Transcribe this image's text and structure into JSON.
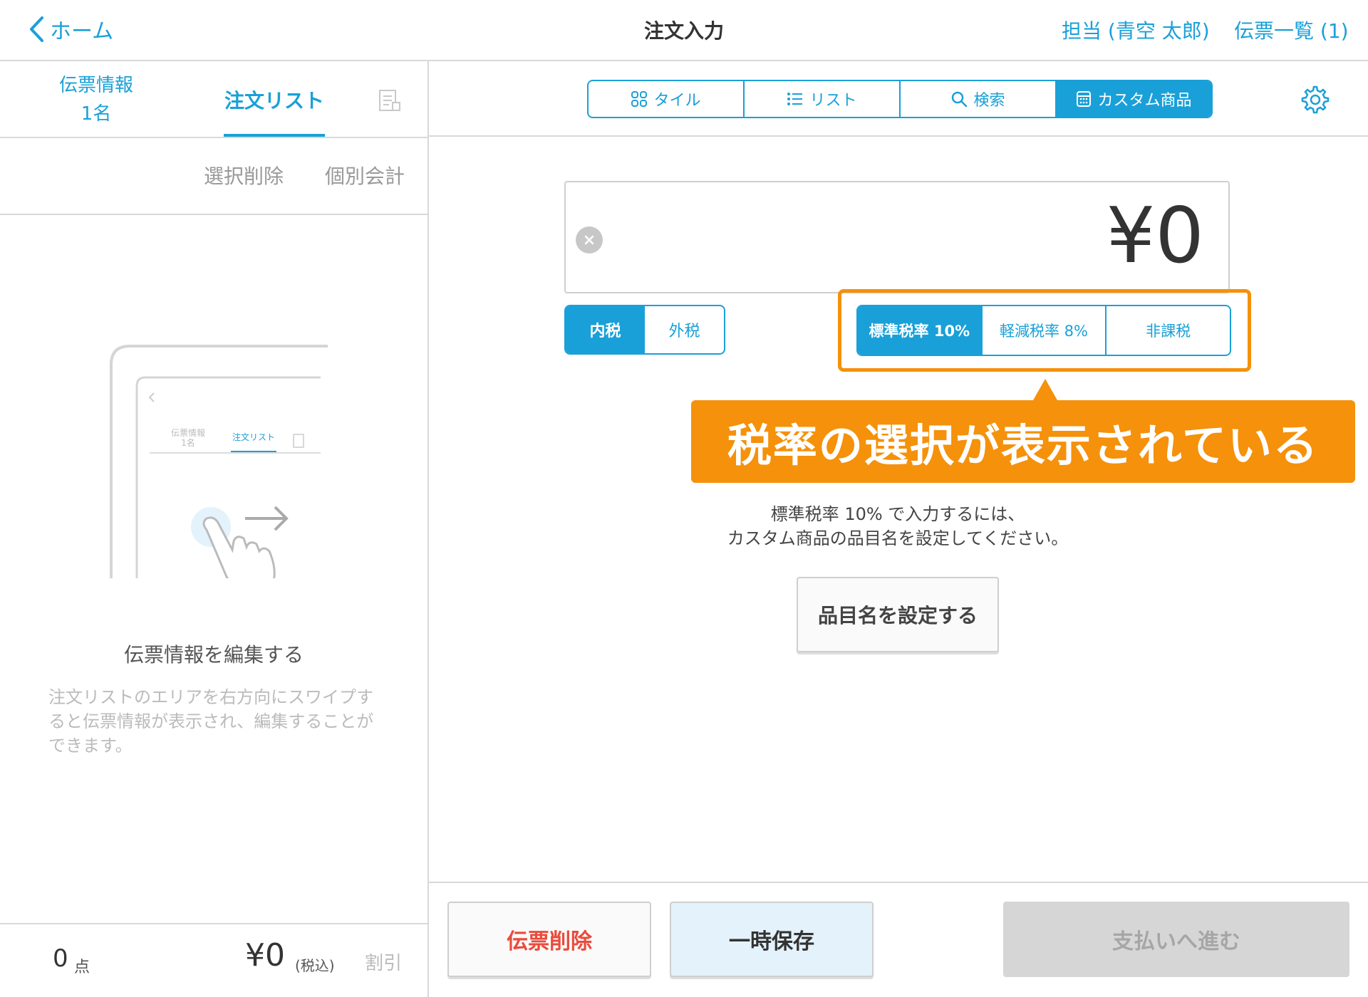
{
  "header": {
    "back_label": "ホーム",
    "title": "注文入力",
    "staff_label": "担当 (青空 太郎)",
    "slip_list_label": "伝票一覧 (1)"
  },
  "left_panel": {
    "tabs": {
      "info_label": "伝票情報",
      "info_count": "1名",
      "orders_label": "注文リスト"
    },
    "actions": {
      "select_delete": "選択削除",
      "split_bill": "個別会計"
    },
    "illustration": {
      "tab_info": "伝票情報",
      "tab_info_count": "1名",
      "tab_orders": "注文リスト"
    },
    "hint_title": "伝票情報を編集する",
    "hint_body": "注文リストのエリアを右方向にスワイプすると伝票情報が表示され、編集することができます。",
    "footer": {
      "count": "0",
      "count_unit": "点",
      "total": "¥0",
      "total_tax_label": "(税込)",
      "discount_label": "割引"
    }
  },
  "right_panel": {
    "view_tabs": [
      {
        "label": "タイル",
        "icon": "tile-grid-icon",
        "active": false
      },
      {
        "label": "リスト",
        "icon": "list-icon",
        "active": false
      },
      {
        "label": "検索",
        "icon": "search-icon",
        "active": false
      },
      {
        "label": "カスタム商品",
        "icon": "calculator-icon",
        "active": true
      }
    ],
    "settings_icon": "gear-icon",
    "amount": "¥0",
    "tax_mode": [
      {
        "label": "内税",
        "active": true
      },
      {
        "label": "外税",
        "active": false
      }
    ],
    "tax_rate": [
      {
        "label": "標準税率 10%",
        "active": true
      },
      {
        "label": "軽減税率 8%",
        "active": false
      },
      {
        "label": "非課税",
        "active": false
      }
    ],
    "callout": "税率の選択が表示されている",
    "instruction_line1": "標準税率 10% で入力するには、",
    "instruction_line2": "カスタム商品の品目名を設定してください。",
    "set_name_button": "品目名を設定する"
  },
  "footer_buttons": {
    "delete_slip": "伝票削除",
    "hold": "一時保存",
    "proceed_payment": "支払いへ進む"
  },
  "colors": {
    "accent": "#1aa0d8",
    "callout": "#f5910a",
    "danger": "#e94b3c",
    "disabled": "#d6d6d6"
  }
}
